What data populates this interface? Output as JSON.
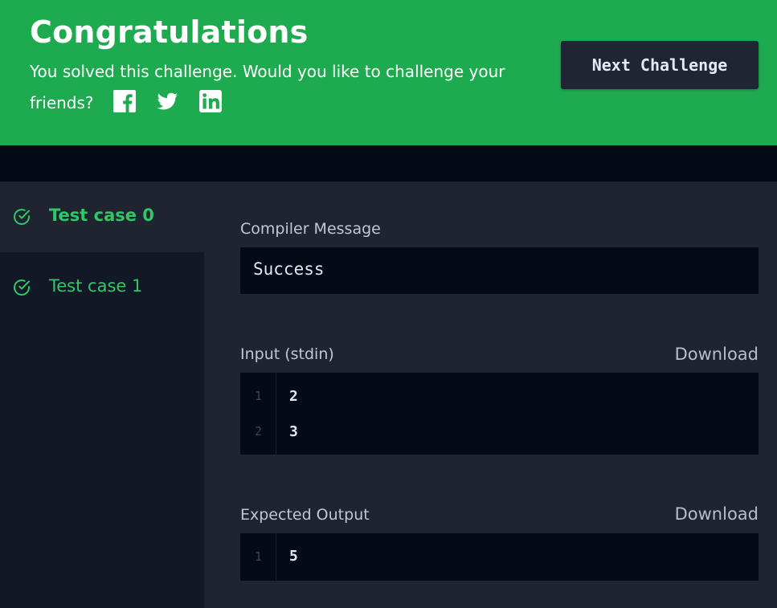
{
  "banner": {
    "title": "Congratulations",
    "message": "You solved this challenge. Would you like to challenge your friends?",
    "message_line1": "You solved this challenge. Would you like to challenge your",
    "message_line2": "friends?",
    "social_icons": [
      "facebook-icon",
      "twitter-icon",
      "linkedin-icon"
    ],
    "next_button": "Next Challenge",
    "bg_color": "#1eaa4f"
  },
  "sidebar": {
    "test_cases": [
      {
        "label": "Test case 0",
        "status": "passed",
        "active": true
      },
      {
        "label": "Test case 1",
        "status": "passed",
        "active": false
      }
    ],
    "accent_color": "#2ec866"
  },
  "main": {
    "compiler": {
      "label": "Compiler Message",
      "value": "Success"
    },
    "input": {
      "label": "Input (stdin)",
      "download": "Download",
      "lines": [
        {
          "n": "1",
          "text": "2"
        },
        {
          "n": "2",
          "text": "3"
        }
      ]
    },
    "expected": {
      "label": "Expected Output",
      "download": "Download",
      "lines": [
        {
          "n": "1",
          "text": "5"
        }
      ]
    }
  }
}
